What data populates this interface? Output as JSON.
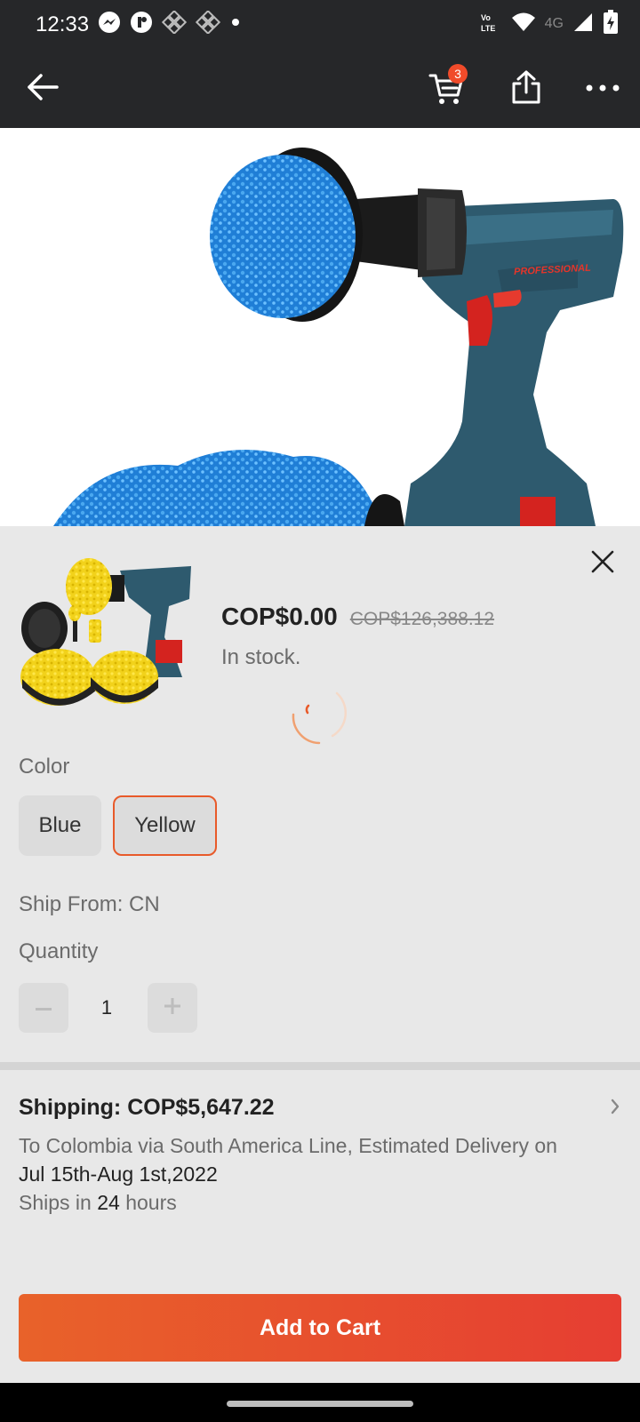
{
  "status_bar": {
    "time": "12:33",
    "network": "4G",
    "left_icons": [
      "messenger-icon",
      "app-icon",
      "mesh-icon",
      "mesh-icon",
      "dot-icon"
    ],
    "right_icons": [
      "volte-icon",
      "wifi-icon",
      "signal-icon",
      "battery-icon"
    ]
  },
  "top_bar": {
    "cart_count": "3",
    "icons": [
      "back-arrow-icon",
      "cart-icon",
      "share-icon",
      "more-icon"
    ]
  },
  "product_sheet": {
    "price": "COP$0.00",
    "original_price": "COP$126,388.12",
    "stock_status": "In stock.",
    "color_label": "Color",
    "colors": [
      {
        "label": "Blue",
        "selected": false
      },
      {
        "label": "Yellow",
        "selected": true
      }
    ],
    "ship_from": "Ship From: CN",
    "quantity_label": "Quantity",
    "quantity": "1"
  },
  "shipping": {
    "title": "Shipping: COP$5,647.22",
    "desc_prefix": "To Colombia via South America Line, Estimated Delivery on",
    "delivery_window": "Jul 15th-Aug 1st,2022",
    "ships_in_prefix": "Ships in",
    "ships_in_value": "24",
    "ships_in_suffix": "hours"
  },
  "actions": {
    "add_to_cart": "Add to Cart"
  },
  "colors": {
    "accent": "#e85a2a",
    "badge": "#f04b2a",
    "header_bg": "#262729",
    "sheet_bg": "#e8e8e8"
  }
}
